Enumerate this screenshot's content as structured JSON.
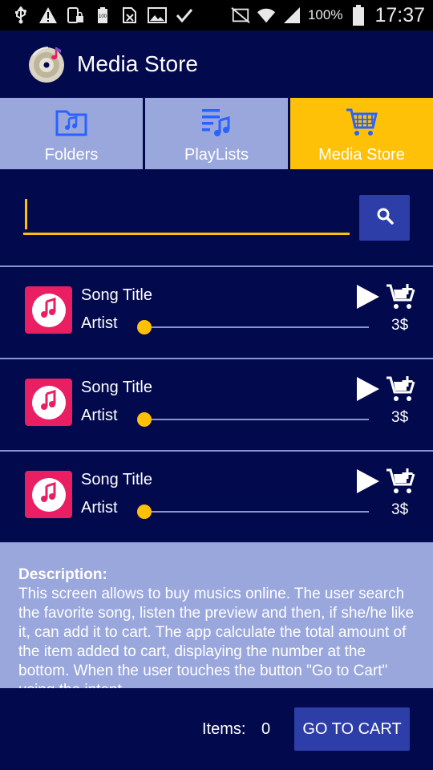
{
  "status_bar": {
    "battery_percent": "100%",
    "time": "17:37",
    "left_icons": [
      "usb-icon",
      "warning-icon",
      "screen-lock-icon",
      "battery-100-icon",
      "blocked-sim-icon",
      "image-icon",
      "check-icon"
    ],
    "right_icons": [
      "nfc-mute-icon",
      "wifi-icon",
      "signal-icon",
      "battery-icon"
    ]
  },
  "app_bar": {
    "title": "Media Store",
    "logo_icon": "cd-music-logo-icon"
  },
  "tabs": [
    {
      "label": "Folders",
      "icon": "music-folder-icon",
      "active": false
    },
    {
      "label": "PlayLists",
      "icon": "playlist-icon",
      "active": false
    },
    {
      "label": "Media Store",
      "icon": "shopping-cart-icon",
      "active": true
    }
  ],
  "search": {
    "value": "",
    "placeholder": "",
    "button_icon": "search-icon"
  },
  "songs": [
    {
      "title": "Song Title",
      "artist": "Artist",
      "price": "3$",
      "progress": 0
    },
    {
      "title": "Song Title",
      "artist": "Artist",
      "price": "3$",
      "progress": 0
    },
    {
      "title": "Song Title",
      "artist": "Artist",
      "price": "3$",
      "progress": 0
    }
  ],
  "description": {
    "label": "Description:",
    "text": "This screen allows to buy musics online. The user search the favorite song, listen the preview and then, if she/he like it, can add it to cart. The app calculate the total amount of the item added to cart, displaying the number at the bottom. When the user touches the button \"Go to Cart\" using the intent"
  },
  "footer": {
    "items_label": "Items:",
    "items_count": "0",
    "cart_button": "GO TO CART"
  },
  "colors": {
    "primary": "#02094d",
    "accent": "#ffc107",
    "tab_bg": "#9aa7dd",
    "button": "#2e3ea8",
    "art": "#e91e63"
  }
}
